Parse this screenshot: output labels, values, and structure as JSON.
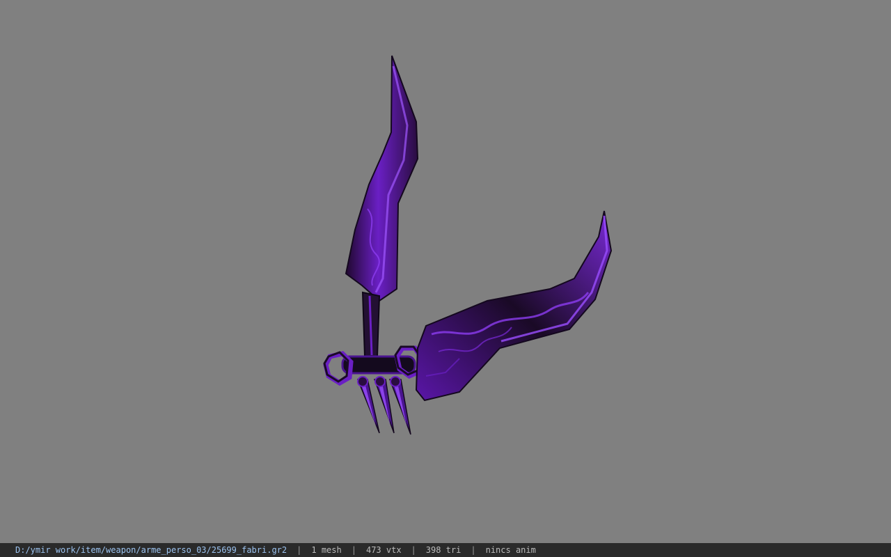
{
  "window": {
    "background_color": "#808080",
    "model_colors": {
      "purple": "#6a1fc4",
      "highlight": "#9a4dff",
      "dark": "#160a24"
    }
  },
  "status_bar": {
    "file_path": "D:/ymir work/item/weapon/arme_perso_03/25699_fabri.gr2",
    "mesh_count": "1 mesh",
    "vertex_count": "473 vtx",
    "triangle_count": "398 tri",
    "animation": "nincs anim",
    "separator": "|"
  }
}
